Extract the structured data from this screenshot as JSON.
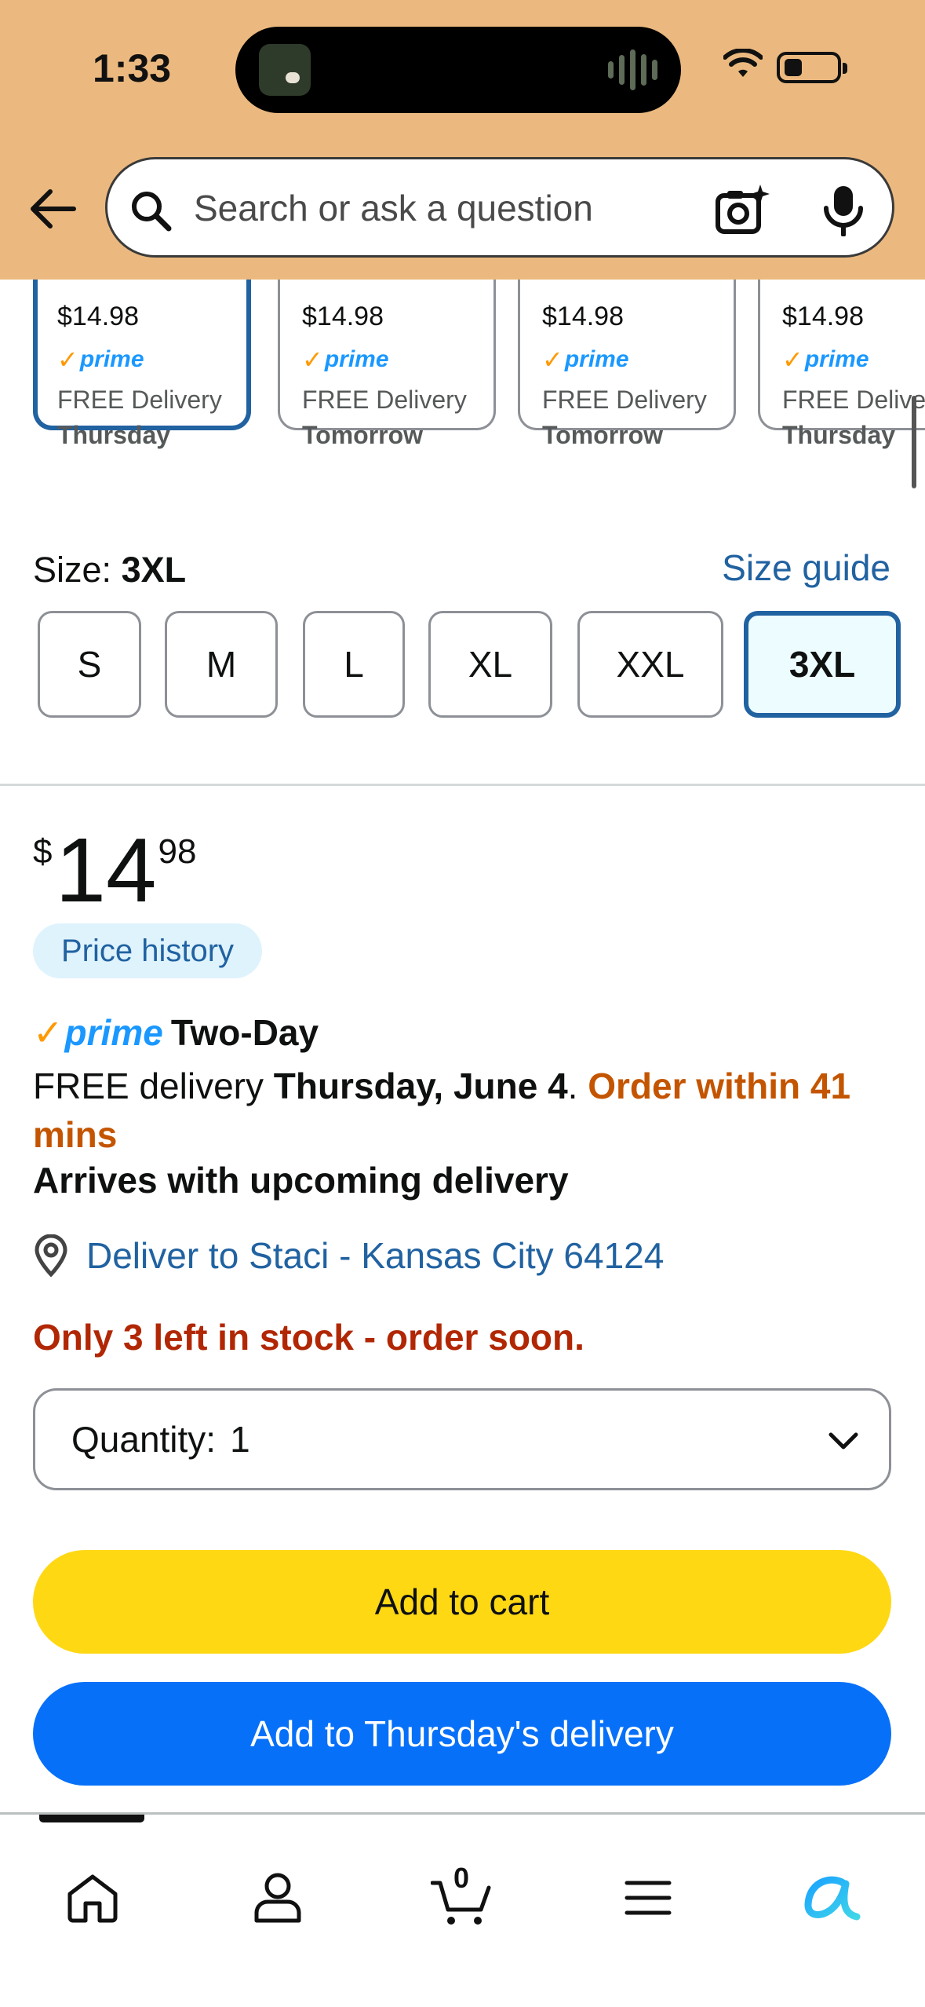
{
  "status_bar": {
    "time": "1:33"
  },
  "search": {
    "placeholder": "Search or ask a question"
  },
  "variants": [
    {
      "price": "$14.98",
      "prime": "prime",
      "delivery": "FREE Delivery",
      "day": "Thursday",
      "selected": true
    },
    {
      "price": "$14.98",
      "prime": "prime",
      "delivery": "FREE Delivery",
      "day": "Tomorrow",
      "selected": false
    },
    {
      "price": "$14.98",
      "prime": "prime",
      "delivery": "FREE Delivery",
      "day": "Tomorrow",
      "selected": false
    },
    {
      "price": "$14.98",
      "prime": "prime",
      "delivery": "FREE Delivery",
      "day": "Thursday",
      "selected": false
    }
  ],
  "size": {
    "label": "Size:",
    "selected": "3XL",
    "guide": "Size guide",
    "options": [
      "S",
      "M",
      "L",
      "XL",
      "XXL",
      "3XL"
    ]
  },
  "price": {
    "symbol": "$",
    "whole": "14",
    "fraction": "98"
  },
  "price_history": "Price history",
  "prime": {
    "logo": "prime",
    "speed": "Two-Day"
  },
  "delivery": {
    "prefix": "FREE delivery",
    "date": "Thursday, June 4",
    "sep": ".",
    "urgency": "Order within 41 mins",
    "arrives": "Arrives with upcoming delivery"
  },
  "deliver_to": "Deliver to Staci - Kansas City 64124",
  "stock": "Only 3 left in stock - order soon.",
  "quantity": {
    "label": "Quantity:",
    "value": "1"
  },
  "buttons": {
    "add_to_cart": "Add to cart",
    "add_to_delivery": "Add to Thursday's delivery"
  },
  "nav": {
    "cart_count": "0",
    "items": [
      "home-icon",
      "account-icon",
      "cart-icon",
      "menu-icon",
      "rufus-icon"
    ]
  },
  "colors": {
    "header_bg": "#ebb97f",
    "link": "#2162a1",
    "selected_border": "#2162a1",
    "urgent": "#c45500",
    "stock": "#b12704",
    "cart_button": "#ffd814",
    "delivery_button": "#0770f8",
    "prime_blue": "#1a98ff",
    "prime_check": "#ff9900"
  }
}
